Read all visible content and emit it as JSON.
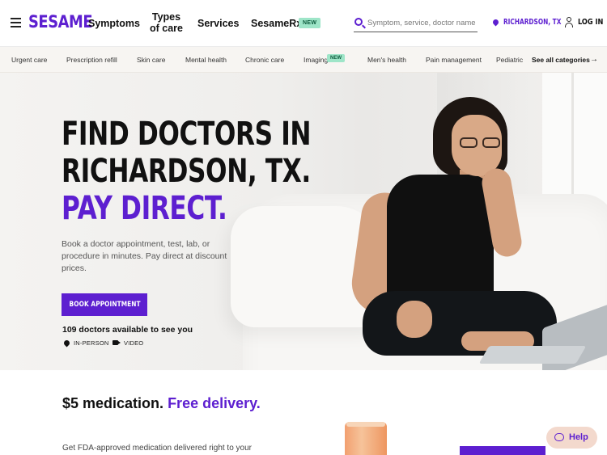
{
  "header": {
    "logo": "SESAME",
    "nav": {
      "symptoms": "Symptoms",
      "types_of_care_line1": "Types",
      "types_of_care_line2": "of care",
      "services": "Services",
      "sesamerx": "SesameRx",
      "sesamerx_badge": "NEW"
    },
    "search_placeholder": "Symptom, service, doctor name",
    "location": "RICHARDSON, TX",
    "login": "LOG IN"
  },
  "categories": {
    "items": [
      "Urgent care",
      "Prescription refill",
      "Skin care",
      "Mental health",
      "Chronic care",
      "Imaging",
      "Men's health",
      "Pain management",
      "Pediatric"
    ],
    "imaging_badge": "NEW",
    "see_all": "See all categories"
  },
  "hero": {
    "title_line1": "FIND DOCTORS IN",
    "title_line2": "RICHARDSON, TX.",
    "title_line3": "PAY DIRECT.",
    "subtitle": "Book a doctor appointment, test, lab, or procedure in minutes. Pay direct at discount prices.",
    "cta": "BOOK APPOINTMENT",
    "doctor_count": "109 doctors available to see you",
    "visit_types": [
      "IN-PERSON",
      "VIDEO"
    ]
  },
  "promo": {
    "title_prefix": "$5 medication.",
    "title_accent": "Free delivery.",
    "subtitle": "Get FDA-approved medication delivered right to your"
  },
  "help": {
    "label": "Help"
  },
  "colors": {
    "brand": "#5d1fd0",
    "badge_green": "#9ee5c8",
    "help_bg": "#f3d9cd"
  }
}
